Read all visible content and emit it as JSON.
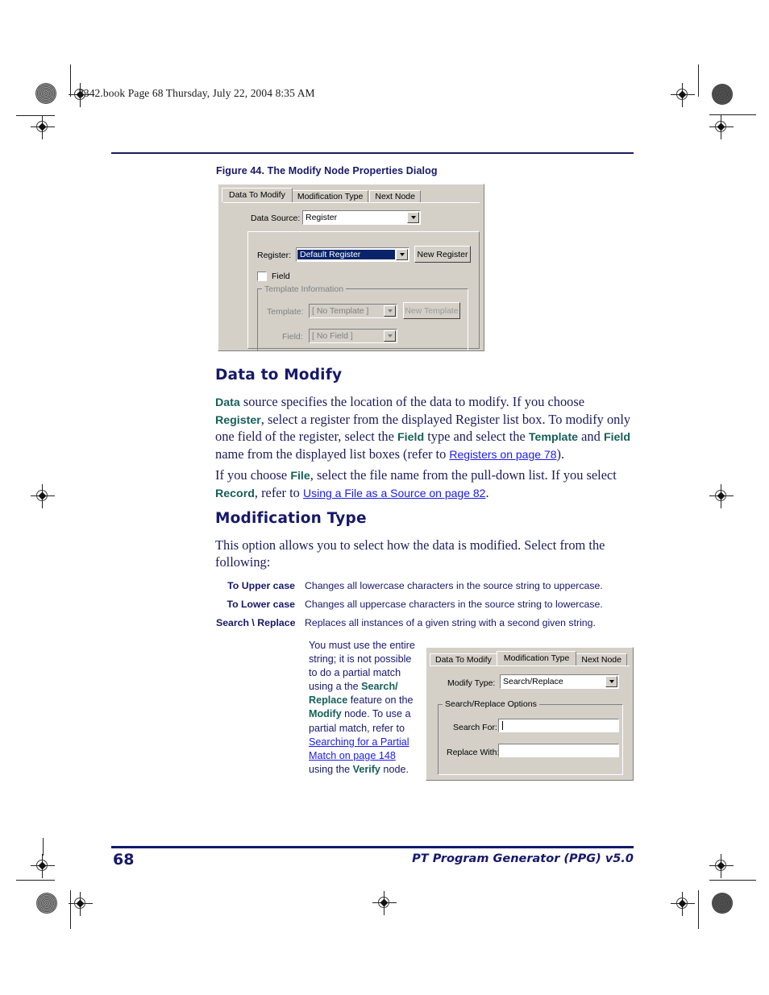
{
  "page": {
    "header_slug": "2342.book  Page 68  Thursday, July 22, 2004  8:35 AM",
    "page_number": "68",
    "footer_title": "PT Program Generator (PPG)  v5.0",
    "accent_navy": "#16186b",
    "accent_teal": "#16605a",
    "link_blue": "#1a1aee"
  },
  "figure": {
    "caption": "Figure 44. The Modify Node Properties Dialog"
  },
  "dialog_data_to_modify": {
    "tabs": [
      {
        "label": "Data To Modify",
        "active": true
      },
      {
        "label": "Modification Type",
        "active": false
      },
      {
        "label": "Next Node",
        "active": false
      }
    ],
    "data_source_label": "Data Source:",
    "data_source_value": "Register",
    "register_label": "Register:",
    "register_value": "Default Register",
    "new_register_button": "New Register",
    "field_checkbox_label": "Field",
    "template_group_title": "Template Information",
    "template_label": "Template:",
    "template_value": "[ No Template ]",
    "new_template_button": "New Template",
    "field_label": "Field:",
    "field_value": "[ No Field ]"
  },
  "dialog_modification_type": {
    "tabs": [
      {
        "label": "Data To Modify",
        "active": false
      },
      {
        "label": "Modification Type",
        "active": true
      },
      {
        "label": "Next Node",
        "active": false
      }
    ],
    "modify_type_label": "Modify Type:",
    "modify_type_value": "Search/Replace",
    "options_group_title": "Search/Replace Options",
    "search_for_label": "Search For:",
    "search_for_value": "",
    "replace_with_label": "Replace With:",
    "replace_with_value": ""
  },
  "sections": {
    "data_to_modify_heading": "Data to Modify",
    "modification_type_heading": "Modification Type"
  },
  "paragraphs": {
    "p1": {
      "t1": "Data",
      "t2": " source specifies the location of the data to modify. If you choose ",
      "t3": "Register",
      "t4": ", select a register from the displayed Register list box. To modify only one field of the register, select the ",
      "t5": "Field",
      "t6": " type and select the ",
      "t7": "Template",
      "t8": " and ",
      "t9": "Field",
      "t10": " name from the displayed list boxes (refer to ",
      "link": "Registers on page 78",
      "t11": ")."
    },
    "p2": {
      "t1": "If you choose ",
      "t2": "File",
      "t3": ", select the file name from the pull-down list. If you select ",
      "t4": "Record",
      "t5": ", refer to ",
      "link": "Using a File as a Source on page 82",
      "t6": "."
    },
    "p3": {
      "t1": "This option allows you to select how the data is modified. Select from the following:"
    },
    "narrow": {
      "t1": "You must use the entire string; it is not possible to do a partial match using a the ",
      "t2": "Search/ Replace",
      "t3": " feature on the ",
      "t4": "Modify",
      "t5": " node. To use a partial match, refer to ",
      "link": "Searching for a Partial Match on page 148",
      "t6": " using the ",
      "t7": "Verify",
      "t8": " node."
    }
  },
  "definition_list": [
    {
      "term": "To Upper case",
      "desc": "Changes all lowercase characters in the source string to uppercase."
    },
    {
      "term": "To Lower case",
      "desc": "Changes all uppercase characters in the source string to lowercase."
    },
    {
      "term": "Search \\ Replace",
      "desc": "Replaces all instances of a given string with a second given string."
    }
  ]
}
